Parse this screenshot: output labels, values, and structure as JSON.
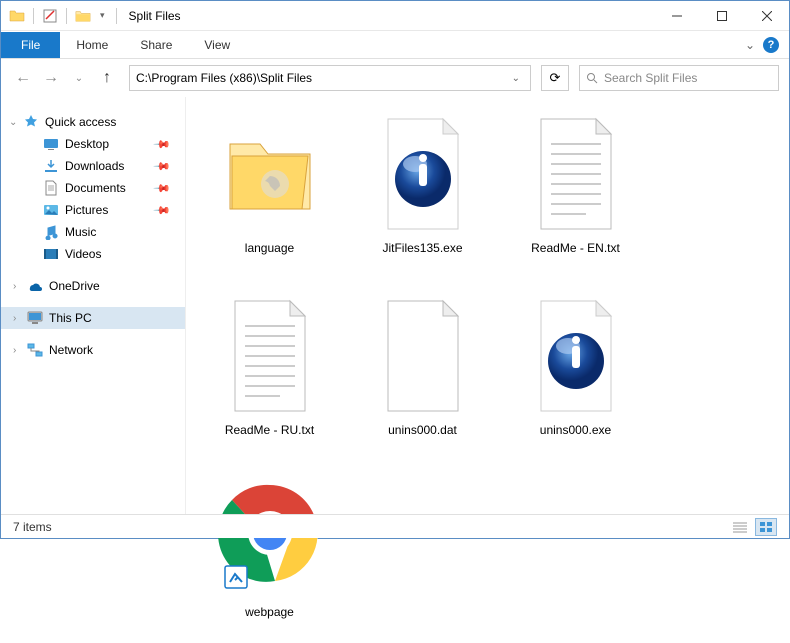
{
  "titlebar": {
    "window_title": "Split Files"
  },
  "ribbon": {
    "file": "File",
    "tabs": [
      "Home",
      "Share",
      "View"
    ]
  },
  "nav": {
    "address": "C:\\Program Files (x86)\\Split Files",
    "search_placeholder": "Search Split Files"
  },
  "sidebar": {
    "quick_access": "Quick access",
    "items": [
      {
        "label": "Desktop",
        "pinned": true
      },
      {
        "label": "Downloads",
        "pinned": true
      },
      {
        "label": "Documents",
        "pinned": true
      },
      {
        "label": "Pictures",
        "pinned": true
      },
      {
        "label": "Music",
        "pinned": false
      },
      {
        "label": "Videos",
        "pinned": false
      }
    ],
    "onedrive": "OneDrive",
    "thispc": "This PC",
    "network": "Network"
  },
  "files": [
    {
      "name": "language",
      "type": "folder"
    },
    {
      "name": "JitFiles135.exe",
      "type": "exe-info"
    },
    {
      "name": "ReadMe - EN.txt",
      "type": "txt"
    },
    {
      "name": "ReadMe - RU.txt",
      "type": "txt"
    },
    {
      "name": "unins000.dat",
      "type": "blank"
    },
    {
      "name": "unins000.exe",
      "type": "exe-info"
    },
    {
      "name": "webpage",
      "type": "chrome-shortcut"
    }
  ],
  "statusbar": {
    "count": "7 items"
  }
}
